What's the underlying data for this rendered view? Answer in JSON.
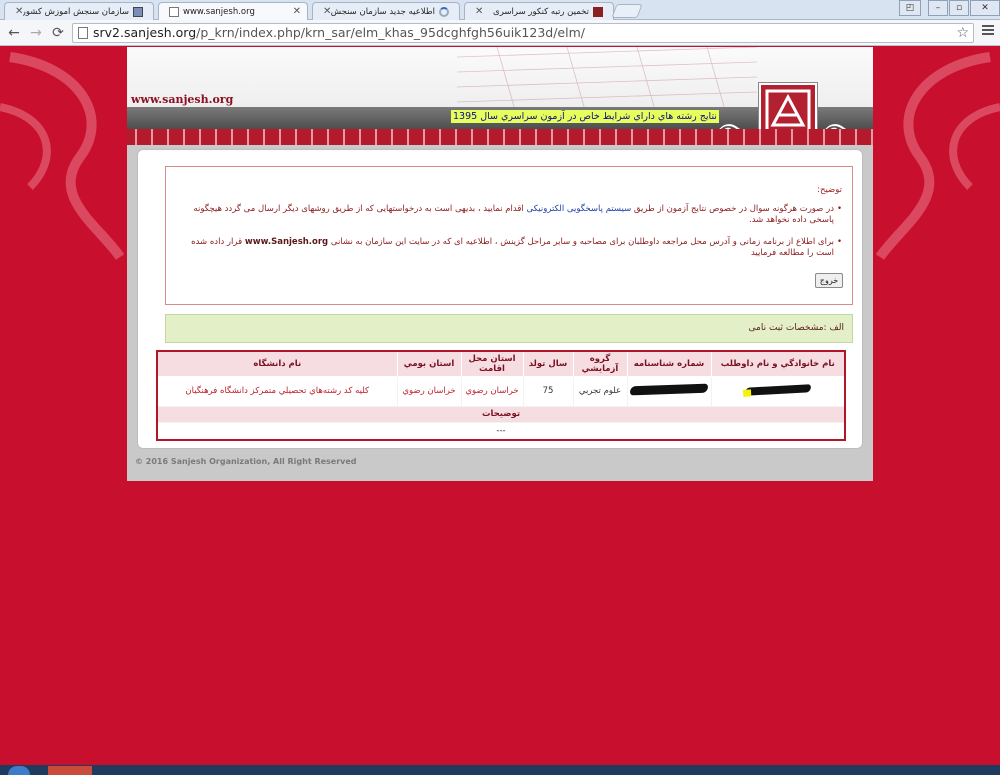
{
  "browser": {
    "tabs": [
      {
        "title": "سازمان سنجش آموزش کشور",
        "active": false
      },
      {
        "title": "www.sanjesh.org",
        "active": true
      },
      {
        "title": "اطلاعیه جدید سازمان سنجش در ...",
        "active": false
      },
      {
        "title": "تخمین رتبه کنکور سراسری",
        "active": false
      }
    ],
    "address": {
      "host": "srv2.sanjesh.org",
      "path": "/p_krn/index.php/krn_sar/elm_khas_95dcghfgh56uik123d/elm/"
    },
    "icons": {
      "back": "back-arrow-icon",
      "forward": "forward-arrow-icon",
      "reload": "reload-icon",
      "bookmark": "star-icon",
      "menu": "menu-icon"
    }
  },
  "banner": {
    "site_url": "www.sanjesh.org",
    "ticker": "نتايج رشته هاي داراي شرايط خاص در آزمون سراسري سال 1395"
  },
  "notice": {
    "title": "توضیح:",
    "item1_pre": "در صورت هرگونه سوال در خصوص نتایج آزمون از طریق ",
    "item1_link": "سیستم پاسخگویی الکترونیکی",
    "item1_post": " اقدام نمایید ، بدیهی است به درخواستهایی که از طریق روشهای دیگر ارسال می گردد هیچگونه پاسخی داده نخواهد شد.",
    "item2_pre": "برای اطلاع از برنامه زمانی و آدرس محل مراجعه داوطلبان برای مصاحبه و سایر مراحل گزینش ، اطلاعیه ای که در سایت این سازمان به نشانی ",
    "item2_link": "www.Sanjesh.org",
    "item2_post": " قرار داده شده است را مطالعه فرمایید",
    "exit_label": "خروج"
  },
  "section": {
    "title": "الف :مشخصات ثبت نامی"
  },
  "table": {
    "headers": [
      "نام خانوادگي و نام داوطلب",
      "شماره شناسنامه",
      "گروه آزمايشي",
      "سال تولد",
      "استان محل اقامت",
      "استان بومي",
      "نام دانشگاه"
    ],
    "row": {
      "name": "",
      "id_number": "",
      "group": "علوم تجربي",
      "birth_year": "75",
      "residence_province": "خراسان رضوي",
      "native_province": "خراسان رضوي",
      "university": "کليه کد رشته‌هاي تحصيلي متمرکز دانشگاه فرهنگيان"
    },
    "desc_header": "توضيحات",
    "desc_value": "---"
  },
  "footer": {
    "copyright": "© 2016 Sanjesh Organization, All Right Reserved"
  },
  "colors": {
    "page_bg": "#c8102e",
    "ticker_bg": "#e6ff5b",
    "table_border": "#b01627",
    "header_bg": "#f6dde2",
    "section_bg": "#e2efc7"
  }
}
